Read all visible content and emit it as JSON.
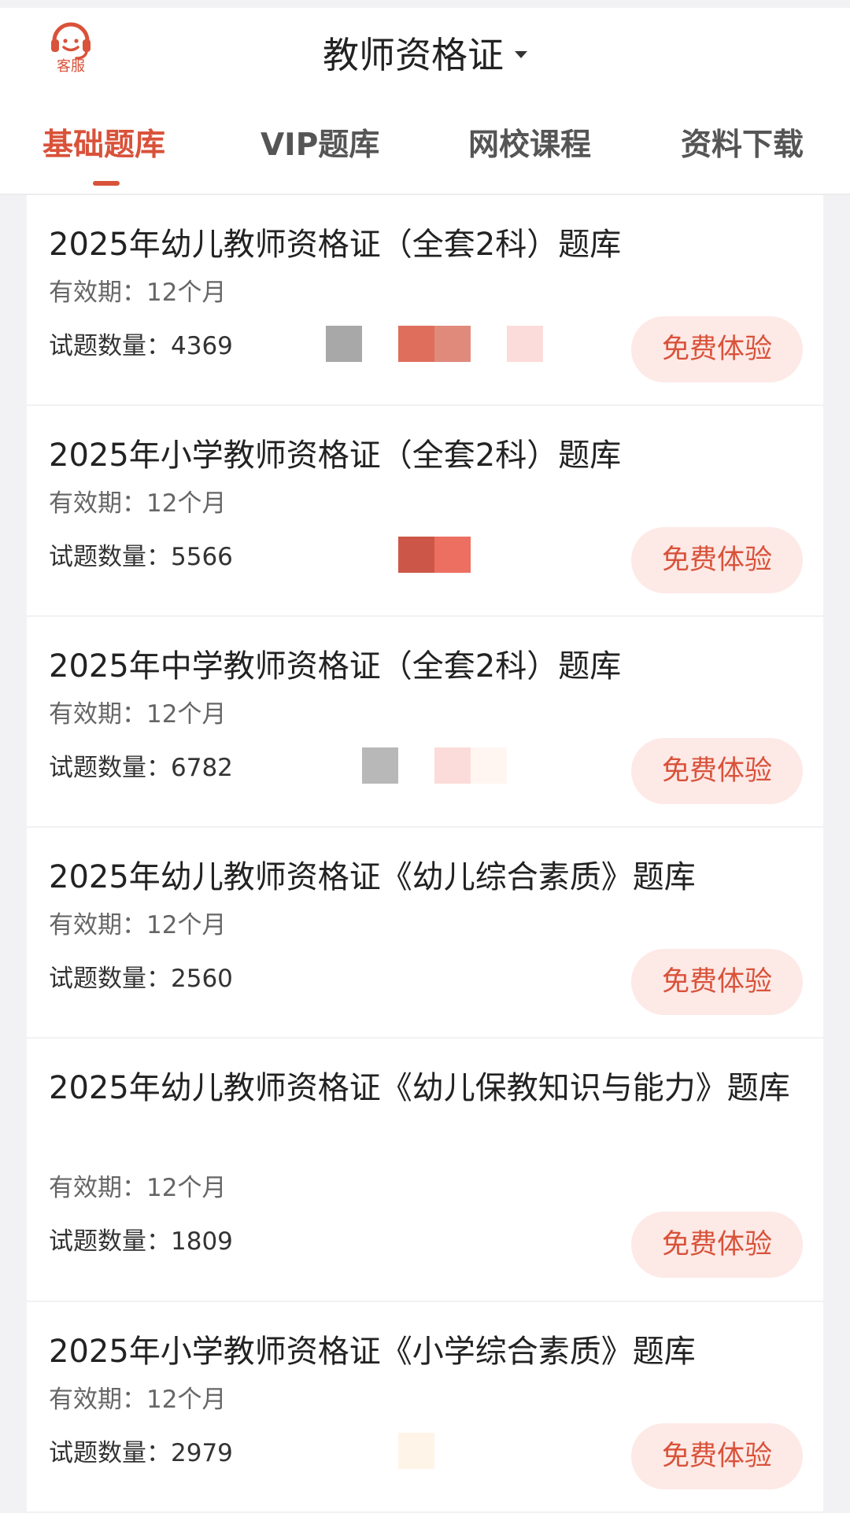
{
  "header": {
    "service_label": "客服",
    "title": "教师资格证"
  },
  "tabs": [
    {
      "label": "基础题库",
      "active": true
    },
    {
      "label": "VIP题库",
      "active": false
    },
    {
      "label": "网校课程",
      "active": false
    },
    {
      "label": "资料下载",
      "active": false
    }
  ],
  "labels": {
    "validity_prefix": "有效期：",
    "count_prefix": "试题数量：",
    "try_button": "免费体验"
  },
  "colors": {
    "accent": "#d9523a",
    "button_bg": "#fde9e6",
    "page_bg": "#f2f2f4"
  },
  "items": [
    {
      "title": "2025年幼儿教师资格证（全套2科）题库",
      "validity": "12个月",
      "count": "4369"
    },
    {
      "title": "2025年小学教师资格证（全套2科）题库",
      "validity": "12个月",
      "count": "5566"
    },
    {
      "title": "2025年中学教师资格证（全套2科）题库",
      "validity": "12个月",
      "count": "6782"
    },
    {
      "title": "2025年幼儿教师资格证《幼儿综合素质》题库",
      "validity": "12个月",
      "count": "2560"
    },
    {
      "title": "2025年幼儿教师资格证《幼儿保教知识与能力》题库",
      "validity": "12个月",
      "count": "1809"
    },
    {
      "title": "2025年小学教师资格证《小学综合素质》题库",
      "validity": "12个月",
      "count": "2979"
    }
  ]
}
